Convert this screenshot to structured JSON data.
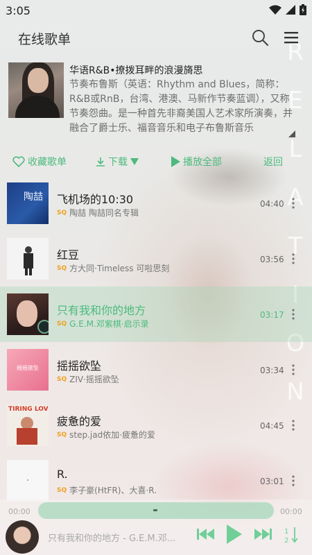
{
  "status_bar": {
    "time": "3:05"
  },
  "header": {
    "title": "在线歌单"
  },
  "playlist": {
    "title": "华语R&B•撩拨耳畔的浪漫旖思",
    "description": "节奏布鲁斯（英语：Rhythm and Blues，简称：R&B或RnB，台湾、港澳、马新作节奏蓝调），又称节奏怨曲。是一种首先非裔美国人艺术家所演奏，并融合了爵士乐、福音音乐和电子布鲁斯音乐"
  },
  "actions": {
    "favorite": "收藏歌单",
    "download": "下载",
    "play_all": "播放全部",
    "back": "返回"
  },
  "songs": [
    {
      "title": "飞机场的10:30",
      "quality": "SQ",
      "subtitle": "陶喆 陶喆同名专辑",
      "duration": "04:40",
      "active": false
    },
    {
      "title": "红豆",
      "quality": "SQ",
      "subtitle": "方大同·Timeless 可啦思刻",
      "duration": "03:56",
      "active": false
    },
    {
      "title": "只有我和你的地方",
      "quality": "SQ",
      "subtitle": "G.E.M.邓紫棋·启示录",
      "duration": "03:17",
      "active": true
    },
    {
      "title": "摇摇欲坠",
      "quality": "SQ",
      "subtitle": "ZIV·摇摇欲坠",
      "duration": "03:34",
      "active": false
    },
    {
      "title": "疲惫的爱",
      "quality": "SQ",
      "subtitle": "step.jad依加·疲惫的爱",
      "duration": "04:45",
      "active": false
    },
    {
      "title": "R.",
      "quality": "SQ",
      "subtitle": "李子豪(HtFR)、大喜·R.",
      "duration": "03:01",
      "active": false
    }
  ],
  "album_art_text": {
    "song1": "陶喆",
    "song4": "摇摇欲坠",
    "song5": "TIRING LOVE"
  },
  "player": {
    "elapsed": "00:00",
    "total": "00:00",
    "now_playing": "只有我和你的地方 - G.E.M.邓...",
    "progress": 0
  },
  "colors": {
    "accent": "#4cba7d",
    "quality_badge": "#f0a020"
  }
}
